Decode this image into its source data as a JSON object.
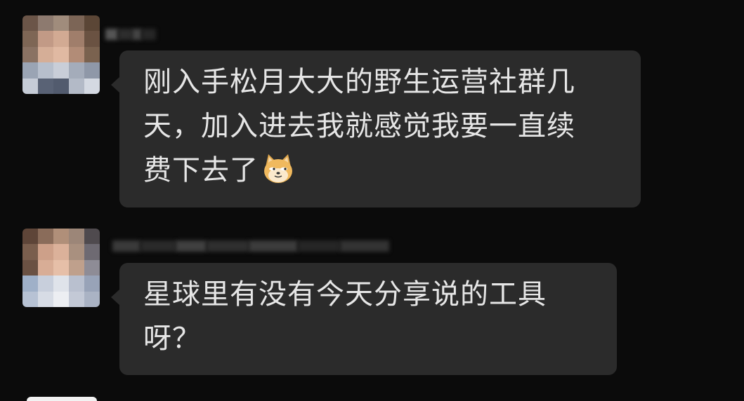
{
  "messages": [
    {
      "sender_name": "",
      "lines": [
        "刚入手松月大大的野生运营社群几",
        "天，加入进去我就感觉我要一直续",
        "费下去了"
      ],
      "trailing_emoji": "doge-emoji"
    },
    {
      "sender_name": "",
      "lines": [
        "星球里有没有今天分享说的工具",
        "呀？"
      ],
      "trailing_emoji": ""
    }
  ],
  "colors": {
    "background": "#0b0b0b",
    "bubble": "#2b2b2b",
    "text": "#e6e6e6"
  }
}
